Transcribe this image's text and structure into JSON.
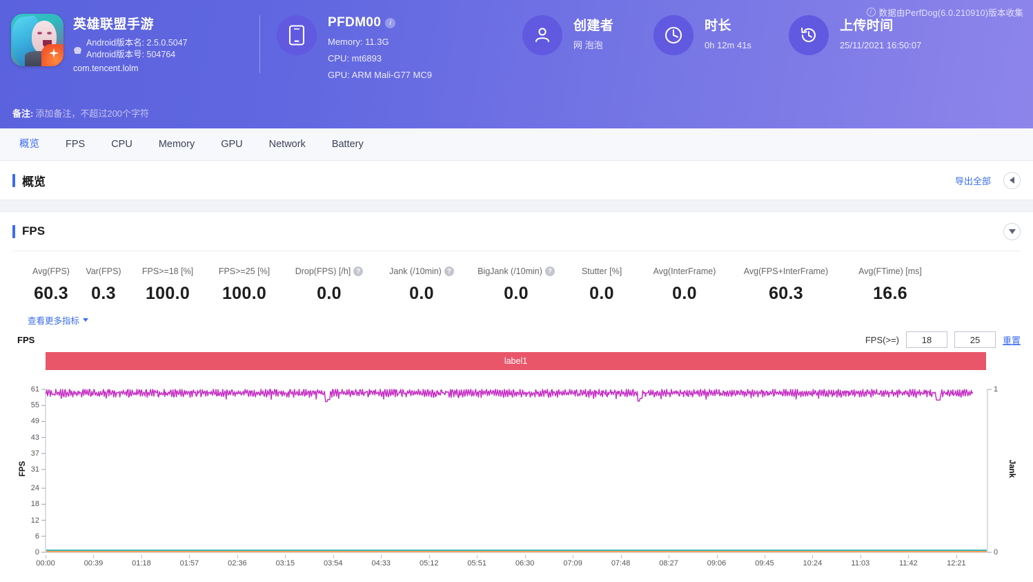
{
  "header": {
    "perfdog_note": "数据由PerfDog(6.0.210910)版本收集",
    "app": {
      "name": "英雄联盟手游",
      "version_name": "Android版本名: 2.5.0.5047",
      "version_code": "Android版本号: 504764",
      "package": "com.tencent.lolm"
    },
    "device": {
      "model": "PFDM00",
      "memory": "Memory: 11.3G",
      "cpu": "CPU: mt6893",
      "gpu": "GPU: ARM Mali-G77 MC9"
    },
    "creator": {
      "title": "创建者",
      "value": "网 泡泡"
    },
    "duration": {
      "title": "时长",
      "value": "0h 12m 41s"
    },
    "upload": {
      "title": "上传时间",
      "value": "25/11/2021 16:50:07"
    },
    "note": {
      "label": "备注:",
      "placeholder": "添加备注，不超过200个字符"
    }
  },
  "tabs": [
    {
      "label": "概览",
      "active": true
    },
    {
      "label": "FPS",
      "active": false
    },
    {
      "label": "CPU",
      "active": false
    },
    {
      "label": "Memory",
      "active": false
    },
    {
      "label": "GPU",
      "active": false
    },
    {
      "label": "Network",
      "active": false
    },
    {
      "label": "Battery",
      "active": false
    }
  ],
  "overview": {
    "title": "概览",
    "export_all": "导出全部"
  },
  "fps_section": {
    "title": "FPS",
    "more_metrics": "查看更多指标",
    "metrics": [
      {
        "label": "Avg(FPS)",
        "value": "60.3",
        "help": false
      },
      {
        "label": "Var(FPS)",
        "value": "0.3",
        "help": false
      },
      {
        "label": "FPS>=18 [%]",
        "value": "100.0",
        "help": false
      },
      {
        "label": "FPS>=25 [%]",
        "value": "100.0",
        "help": false
      },
      {
        "label": "Drop(FPS) [/h]",
        "value": "0.0",
        "help": true
      },
      {
        "label": "Jank (/10min)",
        "value": "0.0",
        "help": true
      },
      {
        "label": "BigJank (/10min)",
        "value": "0.0",
        "help": true
      },
      {
        "label": "Stutter [%]",
        "value": "0.0",
        "help": false
      },
      {
        "label": "Avg(InterFrame)",
        "value": "0.0",
        "help": false
      },
      {
        "label": "Avg(FPS+InterFrame)",
        "value": "60.3",
        "help": false
      },
      {
        "label": "Avg(FTime) [ms]",
        "value": "16.6",
        "help": false
      }
    ],
    "chart_controls": {
      "fps_ge_label": "FPS(>=)",
      "threshold_low": "18",
      "threshold_high": "25",
      "reset": "重置"
    },
    "chart_title": "FPS"
  },
  "chart_data": {
    "type": "line",
    "title": "FPS",
    "legend": [
      "label1"
    ],
    "legend_color": "#e9566a",
    "xlabel": "",
    "ylabel": "FPS",
    "y2label": "Jank",
    "grid": false,
    "xticks": [
      "00:00",
      "00:39",
      "01:18",
      "01:57",
      "02:36",
      "03:15",
      "03:54",
      "04:33",
      "05:12",
      "05:51",
      "06:30",
      "07:09",
      "07:48",
      "08:27",
      "09:06",
      "09:45",
      "10:24",
      "11:03",
      "11:42",
      "12:21"
    ],
    "yticks": [
      61,
      55,
      49,
      43,
      37,
      31,
      24,
      18,
      12,
      6,
      0
    ],
    "ylim": [
      0,
      61
    ],
    "y2ticks": [
      0,
      1
    ],
    "y2lim": [
      0,
      1
    ],
    "series": [
      {
        "name": "FPS",
        "color": "#c42ec4",
        "axis": "left",
        "description": "Dense oscillation between 58 and 61 fps for the whole 12m41s capture, with two brief dips to ~56 near 03:55 and ~08:10",
        "mean": 60.3,
        "variance": 0.3,
        "min": 56,
        "max": 61
      },
      {
        "name": "Jank",
        "color": "#f5a05a",
        "axis": "right",
        "description": "Flat at 0 across entire capture",
        "values_constant": 0
      },
      {
        "name": "InterFrame",
        "color": "#3fb5b5",
        "axis": "right",
        "description": "Flat at 0 across entire capture",
        "values_constant": 0
      }
    ]
  }
}
